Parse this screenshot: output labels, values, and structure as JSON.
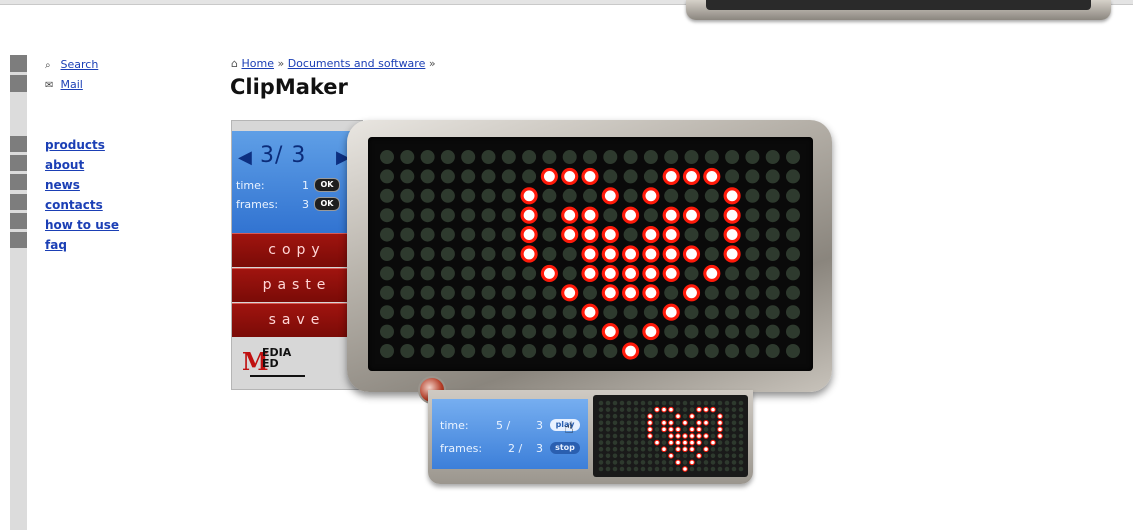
{
  "utility": {
    "search": "Search",
    "mail": "Mail",
    "search_icon": "magnifier-icon",
    "mail_icon": "envelope-icon"
  },
  "nav": [
    "products",
    "about",
    "news",
    "contacts",
    "how to use",
    "faq"
  ],
  "breadcrumb": {
    "home": "Home",
    "sep1": " » ",
    "docs": "Documents and software",
    "sep2": " »"
  },
  "page_title": "ClipMaker",
  "editor": {
    "current": "3",
    "slash_total": "/ 3",
    "time_label": "time:",
    "time_value": "1",
    "frames_label": "frames:",
    "frames_value": "3",
    "ok": "OK",
    "copy": "copy",
    "paste": "paste",
    "save": "save",
    "logo_mark": "M",
    "logo_text_1": "EDIA",
    "logo_text_2": "ED"
  },
  "player": {
    "time_label": "time:",
    "time_value": "5 /",
    "time_total": "3",
    "frames_label": "frames:",
    "frames_value": "2 /",
    "frames_total": "3",
    "play": "play",
    "stop": "stop"
  },
  "led": {
    "cols": 21,
    "rows": 11,
    "on_color": "#ff1a0a",
    "off_color": "#2e3a2e",
    "lit": [
      [
        1,
        8
      ],
      [
        1,
        9
      ],
      [
        1,
        10
      ],
      [
        1,
        14
      ],
      [
        1,
        15
      ],
      [
        1,
        16
      ],
      [
        2,
        7
      ],
      [
        2,
        11
      ],
      [
        2,
        13
      ],
      [
        2,
        17
      ],
      [
        3,
        7
      ],
      [
        3,
        9
      ],
      [
        3,
        10
      ],
      [
        3,
        12
      ],
      [
        3,
        14
      ],
      [
        3,
        15
      ],
      [
        3,
        17
      ],
      [
        4,
        7
      ],
      [
        4,
        9
      ],
      [
        4,
        10
      ],
      [
        4,
        11
      ],
      [
        4,
        13
      ],
      [
        4,
        14
      ],
      [
        4,
        17
      ],
      [
        5,
        7
      ],
      [
        5,
        10
      ],
      [
        5,
        11
      ],
      [
        5,
        12
      ],
      [
        5,
        13
      ],
      [
        5,
        14
      ],
      [
        5,
        15
      ],
      [
        5,
        17
      ],
      [
        6,
        8
      ],
      [
        6,
        10
      ],
      [
        6,
        11
      ],
      [
        6,
        12
      ],
      [
        6,
        13
      ],
      [
        6,
        14
      ],
      [
        6,
        16
      ],
      [
        7,
        9
      ],
      [
        7,
        11
      ],
      [
        7,
        12
      ],
      [
        7,
        13
      ],
      [
        7,
        15
      ],
      [
        8,
        10
      ],
      [
        8,
        14
      ],
      [
        9,
        11
      ],
      [
        9,
        13
      ],
      [
        10,
        12
      ]
    ]
  }
}
